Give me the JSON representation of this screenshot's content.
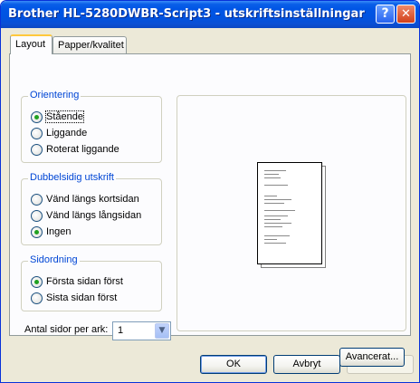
{
  "window": {
    "title": "Brother HL-5280DWBR-Script3 - utskriftsinställningar",
    "help_label": "?",
    "close_label": "✕"
  },
  "tabs": [
    {
      "label": "Layout",
      "active": true
    },
    {
      "label": "Papper/kvalitet",
      "active": false
    }
  ],
  "orientation": {
    "legend": "Orientering",
    "options": [
      {
        "label": "Stående",
        "selected": true
      },
      {
        "label": "Liggande",
        "selected": false
      },
      {
        "label": "Roterat liggande",
        "selected": false
      }
    ]
  },
  "duplex": {
    "legend": "Dubbelsidig utskrift",
    "options": [
      {
        "label": "Vänd längs kortsidan",
        "selected": false
      },
      {
        "label": "Vänd längs långsidan",
        "selected": false
      },
      {
        "label": "Ingen",
        "selected": true
      }
    ]
  },
  "page_order": {
    "legend": "Sidordning",
    "options": [
      {
        "label": "Första sidan först",
        "selected": true
      },
      {
        "label": "Sista sidan först",
        "selected": false
      }
    ]
  },
  "pages_per_sheet": {
    "label": "Antal sidor per ark:",
    "value": "1"
  },
  "buttons": {
    "advanced": "Avancerat...",
    "ok": "OK",
    "cancel": "Avbryt",
    "apply": "Verkställ"
  },
  "colors": {
    "title_bar": "#0055e5",
    "group_legend": "#0046d5",
    "radio_selected": "#21a121",
    "tab_highlight": "#ffc83c"
  }
}
